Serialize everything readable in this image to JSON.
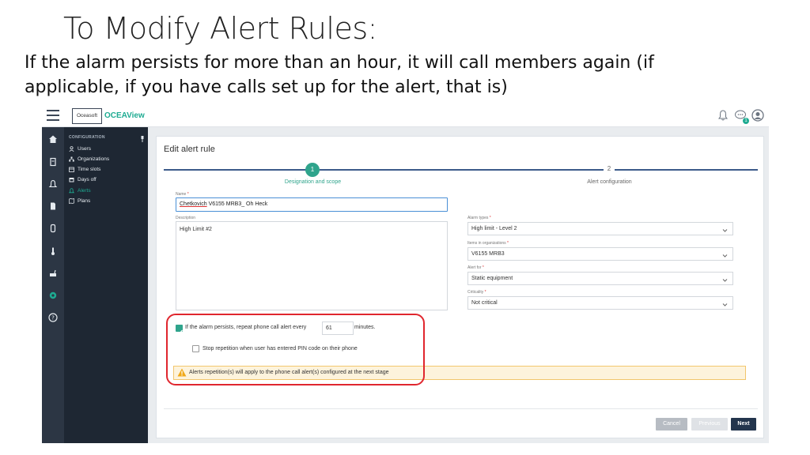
{
  "slide": {
    "title": "To Modify Alert Rules:",
    "subtitle": "If the alarm persists for more than an hour, it will call members again (if applicable, if you have calls set up for the alert, that is)"
  },
  "app": {
    "logo_box": "Oceasoft",
    "logo_name": "OCEAView",
    "notification_badge": "1"
  },
  "nav": {
    "section": "CONFIGURATION",
    "items": [
      {
        "label": "Users",
        "icon": "user-icon"
      },
      {
        "label": "Organizations",
        "icon": "org-icon"
      },
      {
        "label": "Time slots",
        "icon": "timeslot-icon"
      },
      {
        "label": "Days off",
        "icon": "calendar-icon"
      },
      {
        "label": "Alerts",
        "icon": "bell-icon"
      },
      {
        "label": "Plans",
        "icon": "map-icon"
      }
    ]
  },
  "form": {
    "title": "Edit alert rule",
    "steps": [
      {
        "num": "1",
        "label": "Designation and scope"
      },
      {
        "num": "2",
        "label": "Alert configuration"
      }
    ],
    "name_label": "Name",
    "name_value_part1": "Chetkovich",
    "name_value_part2": " V6155 MRB3_ Oh Heck",
    "description_label": "Description",
    "description_value": "High Limit #2",
    "alarm_types_label": "Alarm types",
    "alarm_types_value": "High limit - Level 2",
    "items_label": "Items in organizations",
    "items_value": "V6155 MRB3",
    "alert_for_label": "Alert for",
    "alert_for_value": "Static equipment",
    "criticality_label": "Criticality",
    "criticality_value": "Not critical",
    "repeat_text_before": "If the alarm persists, repeat phone call alert every",
    "repeat_minutes": "61",
    "repeat_text_after": "minutes.",
    "stop_text": "Stop repetition when user has entered PIN code on their phone",
    "warning_text": "Alerts repetition(s) will apply to the phone call alert(s) configured at the next stage",
    "cancel": "Cancel",
    "previous": "Previous",
    "next": "Next"
  },
  "colors": {
    "accent": "#2fa48c",
    "sidebar": "#1e2733",
    "highlight": "#e0262e",
    "primary_button": "#23354d"
  }
}
